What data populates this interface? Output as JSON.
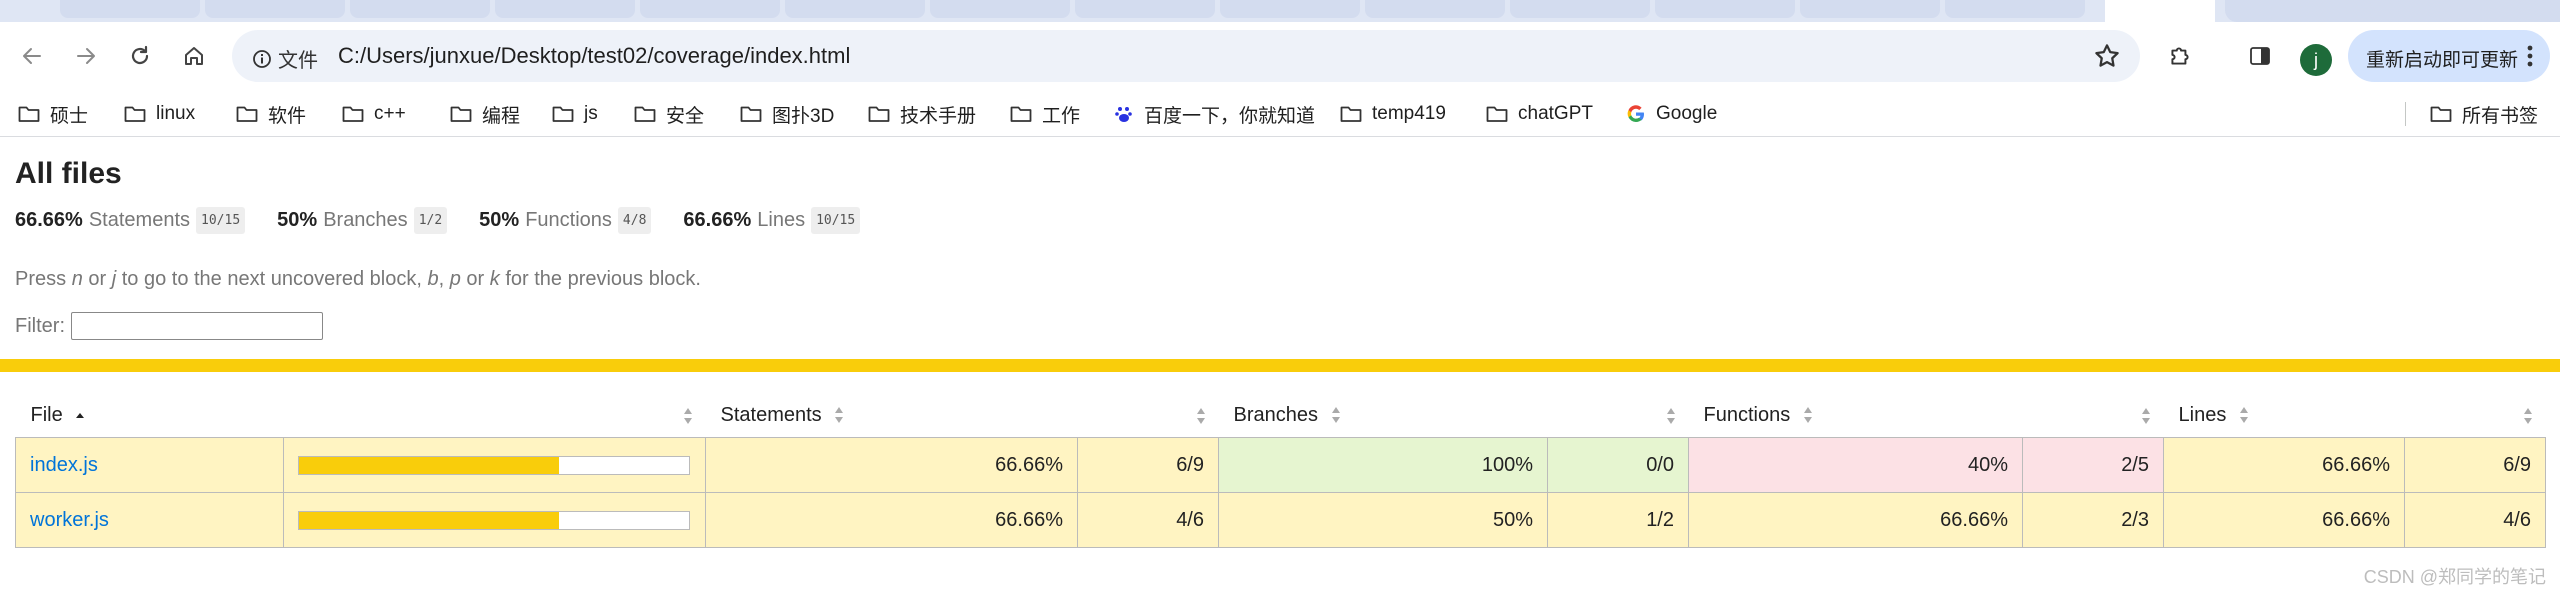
{
  "browser": {
    "omnibox": {
      "info_label": "文件",
      "url": "C:/Users/junxue/Desktop/test02/coverage/index.html"
    },
    "avatar_initial": "j",
    "relaunch_label": "重新启动即可更新",
    "bookmarks": [
      {
        "label": "硕士",
        "icon": "folder-icon"
      },
      {
        "label": "linux",
        "icon": "folder-icon"
      },
      {
        "label": "软件",
        "icon": "folder-icon"
      },
      {
        "label": "c++",
        "icon": "folder-icon"
      },
      {
        "label": "编程",
        "icon": "folder-icon"
      },
      {
        "label": "js",
        "icon": "folder-icon"
      },
      {
        "label": "安全",
        "icon": "folder-icon"
      },
      {
        "label": "图扑3D",
        "icon": "folder-icon"
      },
      {
        "label": "技术手册",
        "icon": "folder-icon"
      },
      {
        "label": "工作",
        "icon": "folder-icon"
      },
      {
        "label": "百度一下，你就知道",
        "icon": "baidu-icon"
      },
      {
        "label": "temp419",
        "icon": "folder-icon"
      },
      {
        "label": "chatGPT",
        "icon": "folder-icon"
      },
      {
        "label": "Google",
        "icon": "google-icon"
      }
    ],
    "all_bookmarks_label": "所有书签"
  },
  "report": {
    "title": "All files",
    "summary": [
      {
        "pct": "66.66%",
        "name": "Statements",
        "frac": "10/15"
      },
      {
        "pct": "50%",
        "name": "Branches",
        "frac": "1/2"
      },
      {
        "pct": "50%",
        "name": "Functions",
        "frac": "4/8"
      },
      {
        "pct": "66.66%",
        "name": "Lines",
        "frac": "10/15"
      }
    ],
    "hint": {
      "p1": "Press ",
      "k1": "n",
      "p2": " or ",
      "k2": "j",
      "p3": " to go to the next uncovered block, ",
      "k3": "b",
      "p4": ", ",
      "k4": "p",
      "p5": " or ",
      "k5": "k",
      "p6": " for the previous block."
    },
    "filter_label": "Filter:",
    "columns": {
      "file": "File",
      "statements": "Statements",
      "branches": "Branches",
      "functions": "Functions",
      "lines": "Lines"
    },
    "rows": [
      {
        "file": "index.js",
        "coverage_fraction": 0.6666,
        "statements_pct": "66.66%",
        "statements_frac": "6/9",
        "branches_pct": "100%",
        "branches_frac": "0/0",
        "functions_pct": "40%",
        "functions_frac": "2/5",
        "lines_pct": "66.66%",
        "lines_frac": "6/9"
      },
      {
        "file": "worker.js",
        "coverage_fraction": 0.6666,
        "statements_pct": "66.66%",
        "statements_frac": "4/6",
        "branches_pct": "50%",
        "branches_frac": "1/2",
        "functions_pct": "66.66%",
        "functions_frac": "2/3",
        "lines_pct": "66.66%",
        "lines_frac": "4/6"
      }
    ]
  },
  "colors": {
    "high": "#e6f5d0",
    "medium": "#fff4c2",
    "low": "#fce1e5",
    "accent": "#f9cd0b",
    "link": "#0074d9"
  },
  "watermark": "CSDN @郑同学的笔记"
}
